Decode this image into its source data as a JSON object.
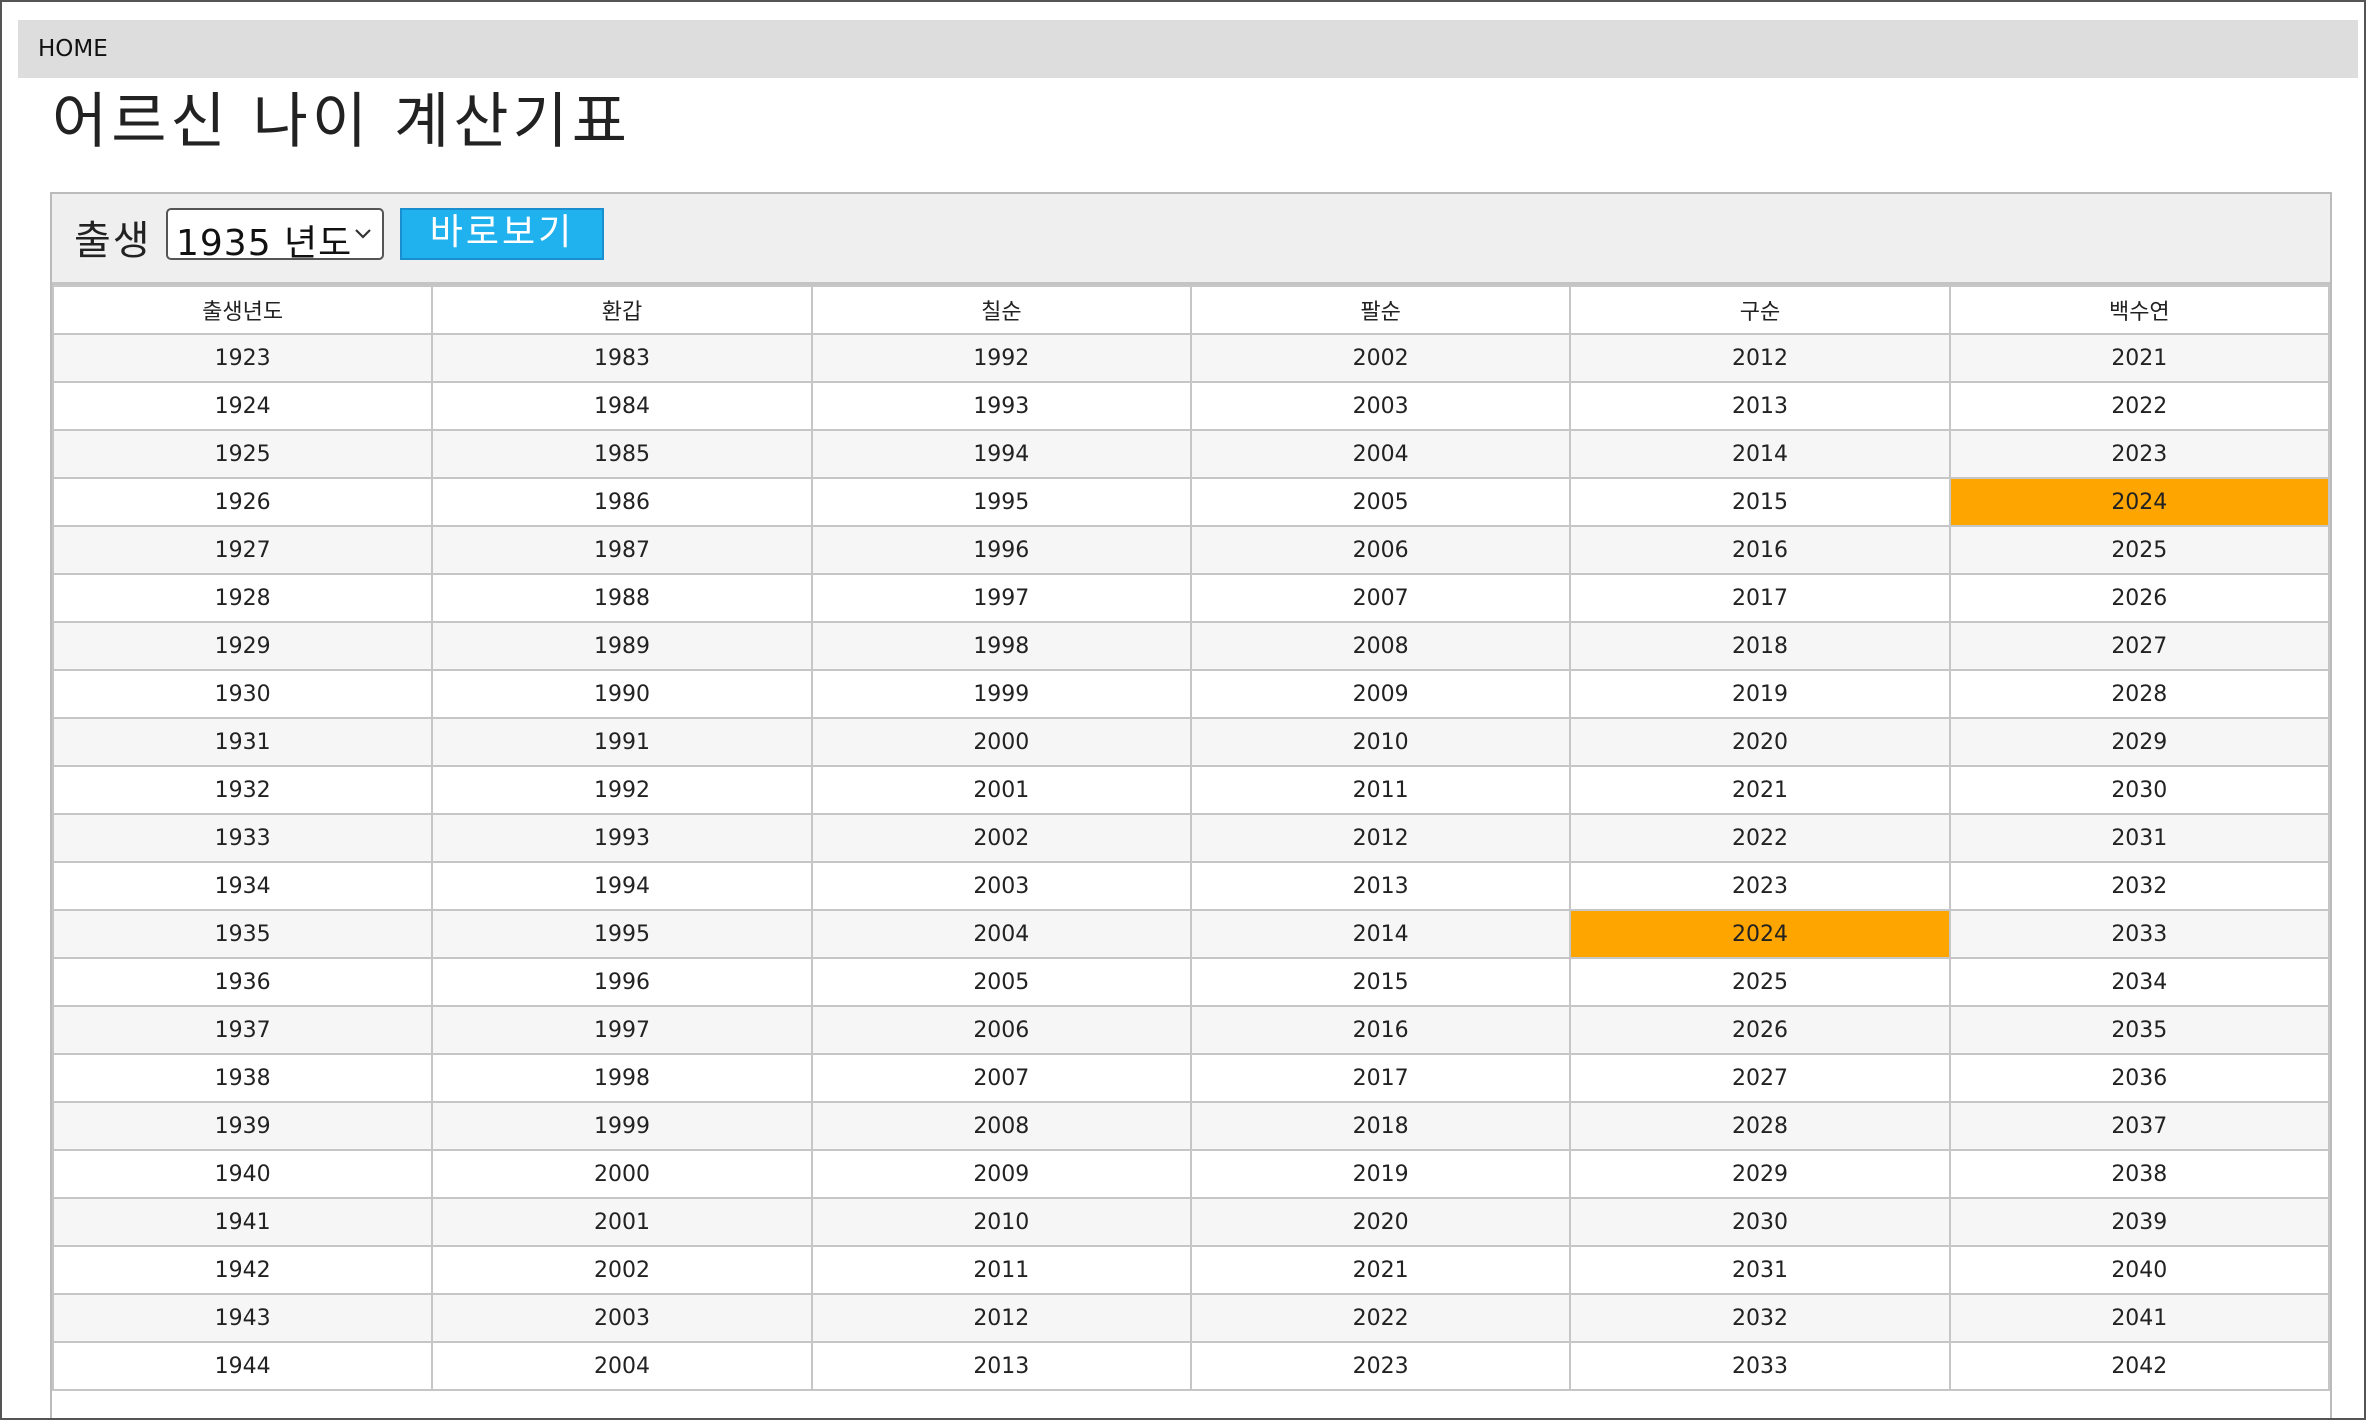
{
  "nav": {
    "home_label": "HOME"
  },
  "page": {
    "title": "어르신 나이 계산기표"
  },
  "filter": {
    "label": "출생",
    "selected_year": "1935 년도",
    "button_label": "바로보기"
  },
  "colors": {
    "highlight": "#ffa500",
    "button": "#1fb2ee"
  },
  "table": {
    "headers": [
      "출생년도",
      "환갑",
      "칠순",
      "팔순",
      "구순",
      "백수연"
    ],
    "rows": [
      [
        "1923",
        "1983",
        "1992",
        "2002",
        "2012",
        "2021"
      ],
      [
        "1924",
        "1984",
        "1993",
        "2003",
        "2013",
        "2022"
      ],
      [
        "1925",
        "1985",
        "1994",
        "2004",
        "2014",
        "2023"
      ],
      [
        "1926",
        "1986",
        "1995",
        "2005",
        "2015",
        "2024"
      ],
      [
        "1927",
        "1987",
        "1996",
        "2006",
        "2016",
        "2025"
      ],
      [
        "1928",
        "1988",
        "1997",
        "2007",
        "2017",
        "2026"
      ],
      [
        "1929",
        "1989",
        "1998",
        "2008",
        "2018",
        "2027"
      ],
      [
        "1930",
        "1990",
        "1999",
        "2009",
        "2019",
        "2028"
      ],
      [
        "1931",
        "1991",
        "2000",
        "2010",
        "2020",
        "2029"
      ],
      [
        "1932",
        "1992",
        "2001",
        "2011",
        "2021",
        "2030"
      ],
      [
        "1933",
        "1993",
        "2002",
        "2012",
        "2022",
        "2031"
      ],
      [
        "1934",
        "1994",
        "2003",
        "2013",
        "2023",
        "2032"
      ],
      [
        "1935",
        "1995",
        "2004",
        "2014",
        "2024",
        "2033"
      ],
      [
        "1936",
        "1996",
        "2005",
        "2015",
        "2025",
        "2034"
      ],
      [
        "1937",
        "1997",
        "2006",
        "2016",
        "2026",
        "2035"
      ],
      [
        "1938",
        "1998",
        "2007",
        "2017",
        "2027",
        "2036"
      ],
      [
        "1939",
        "1999",
        "2008",
        "2018",
        "2028",
        "2037"
      ],
      [
        "1940",
        "2000",
        "2009",
        "2019",
        "2029",
        "2038"
      ],
      [
        "1941",
        "2001",
        "2010",
        "2020",
        "2030",
        "2039"
      ],
      [
        "1942",
        "2002",
        "2011",
        "2021",
        "2031",
        "2040"
      ],
      [
        "1943",
        "2003",
        "2012",
        "2022",
        "2032",
        "2041"
      ],
      [
        "1944",
        "2004",
        "2013",
        "2023",
        "2033",
        "2042"
      ]
    ],
    "highlight_value": "2024"
  }
}
